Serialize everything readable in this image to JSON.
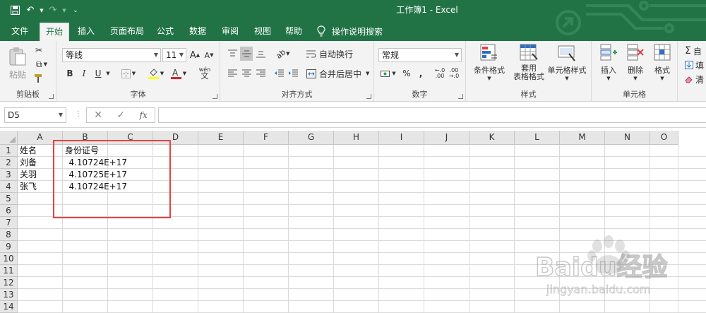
{
  "window": {
    "title": "工作簿1  -  Excel"
  },
  "tabs": [
    {
      "label": "文件",
      "active": false
    },
    {
      "label": "开始",
      "active": true
    },
    {
      "label": "插入",
      "active": false
    },
    {
      "label": "页面布局",
      "active": false
    },
    {
      "label": "公式",
      "active": false
    },
    {
      "label": "数据",
      "active": false
    },
    {
      "label": "审阅",
      "active": false
    },
    {
      "label": "视图",
      "active": false
    },
    {
      "label": "帮助",
      "active": false
    }
  ],
  "tell_me": "操作说明搜索",
  "ribbon": {
    "clipboard": {
      "label": "剪贴板",
      "paste": "粘贴"
    },
    "font": {
      "label": "字体",
      "font_name": "等线",
      "font_size": "11",
      "bold": "B",
      "italic": "I",
      "underline": "U",
      "phonetic": "wén"
    },
    "alignment": {
      "label": "对齐方式",
      "wrap_text": "自动换行",
      "merge_center": "合并后居中"
    },
    "number": {
      "label": "数字",
      "format": "常规",
      "percent": "%",
      "comma": ","
    },
    "styles": {
      "label": "样式",
      "conditional": "条件格式",
      "table_style_1": "套用",
      "table_style_2": "表格格式",
      "cell_style": "单元格样式"
    },
    "cells": {
      "label": "单元格",
      "insert": "插入",
      "delete": "删除",
      "format": "格式"
    },
    "editing": {
      "autosum": "自",
      "fill": "填",
      "clear": "清"
    }
  },
  "formula_bar": {
    "name_box": "D5",
    "fx": "fx",
    "value": ""
  },
  "columns": [
    "A",
    "B",
    "C",
    "D",
    "E",
    "F",
    "G",
    "H",
    "I",
    "J",
    "K",
    "L",
    "M",
    "N",
    "O"
  ],
  "rows": [
    "1",
    "2",
    "3",
    "4",
    "5",
    "6",
    "7",
    "8",
    "9",
    "10",
    "11",
    "12",
    "13",
    "14"
  ],
  "cells": {
    "A1": "姓名",
    "B1": "身份证号",
    "A2": "刘备",
    "B2": "4.10724E+17",
    "A3": "关羽",
    "B3": "4.10725E+17",
    "A4": "张飞",
    "B4": "4.10724E+17"
  },
  "watermark": {
    "logo": "Baidu经验",
    "url": "jingyan.baidu.com"
  },
  "colors": {
    "excel_green": "#217346",
    "highlight_red": "#e8413f"
  }
}
